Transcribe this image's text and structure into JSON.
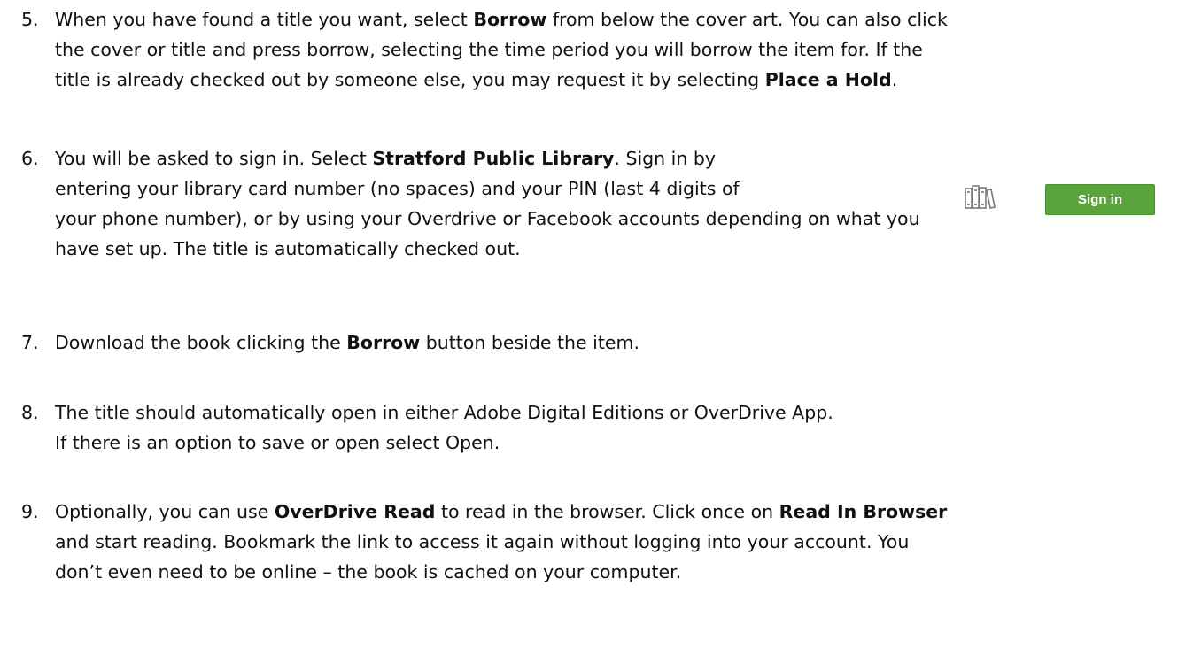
{
  "steps": [
    {
      "number": "5.",
      "lines": [
        [
          "When you have found a title you want, select ",
          "Borrow",
          " from below the cover art. You can also click"
        ],
        [
          "the cover or title and press borrow, selecting the time period you will borrow the item for. If the"
        ],
        [
          "title is already checked out by someone else, you may request it by selecting ",
          "Place a Hold",
          "."
        ]
      ]
    },
    {
      "number": "6.",
      "lines": [
        [
          "You will be asked to sign in. Select ",
          "Stratford Public Library",
          ". Sign in by"
        ],
        [
          "entering your library card number (no spaces) and your PIN (last 4 digits of"
        ],
        [
          "your phone number), or by using your Overdrive or Facebook accounts depending on what you"
        ],
        [
          "have set up. The title is automatically checked out."
        ]
      ]
    },
    {
      "number": "7.",
      "lines": [
        [
          "Download the book clicking the ",
          "Borrow",
          " button beside the item."
        ]
      ]
    },
    {
      "number": "8.",
      "lines": [
        [
          "The title should automatically open in either Adobe Digital Editions or OverDrive App."
        ],
        [
          "If there is an option to save or open select Open."
        ]
      ]
    },
    {
      "number": "9.",
      "lines": [
        [
          "Optionally, you can use ",
          "OverDrive Read",
          " to read in the browser. Click once on ",
          "Read In Browser"
        ],
        [
          "and start reading. Bookmark the link to access it again without logging into your account. You"
        ],
        [
          "don’t even need to be online – the book is cached on your computer."
        ]
      ]
    }
  ],
  "signin_ui": {
    "icon": "library-books-icon",
    "button_label": "Sign in",
    "button_color": "#5aa43c",
    "icon_color": "#7a7a7a"
  }
}
